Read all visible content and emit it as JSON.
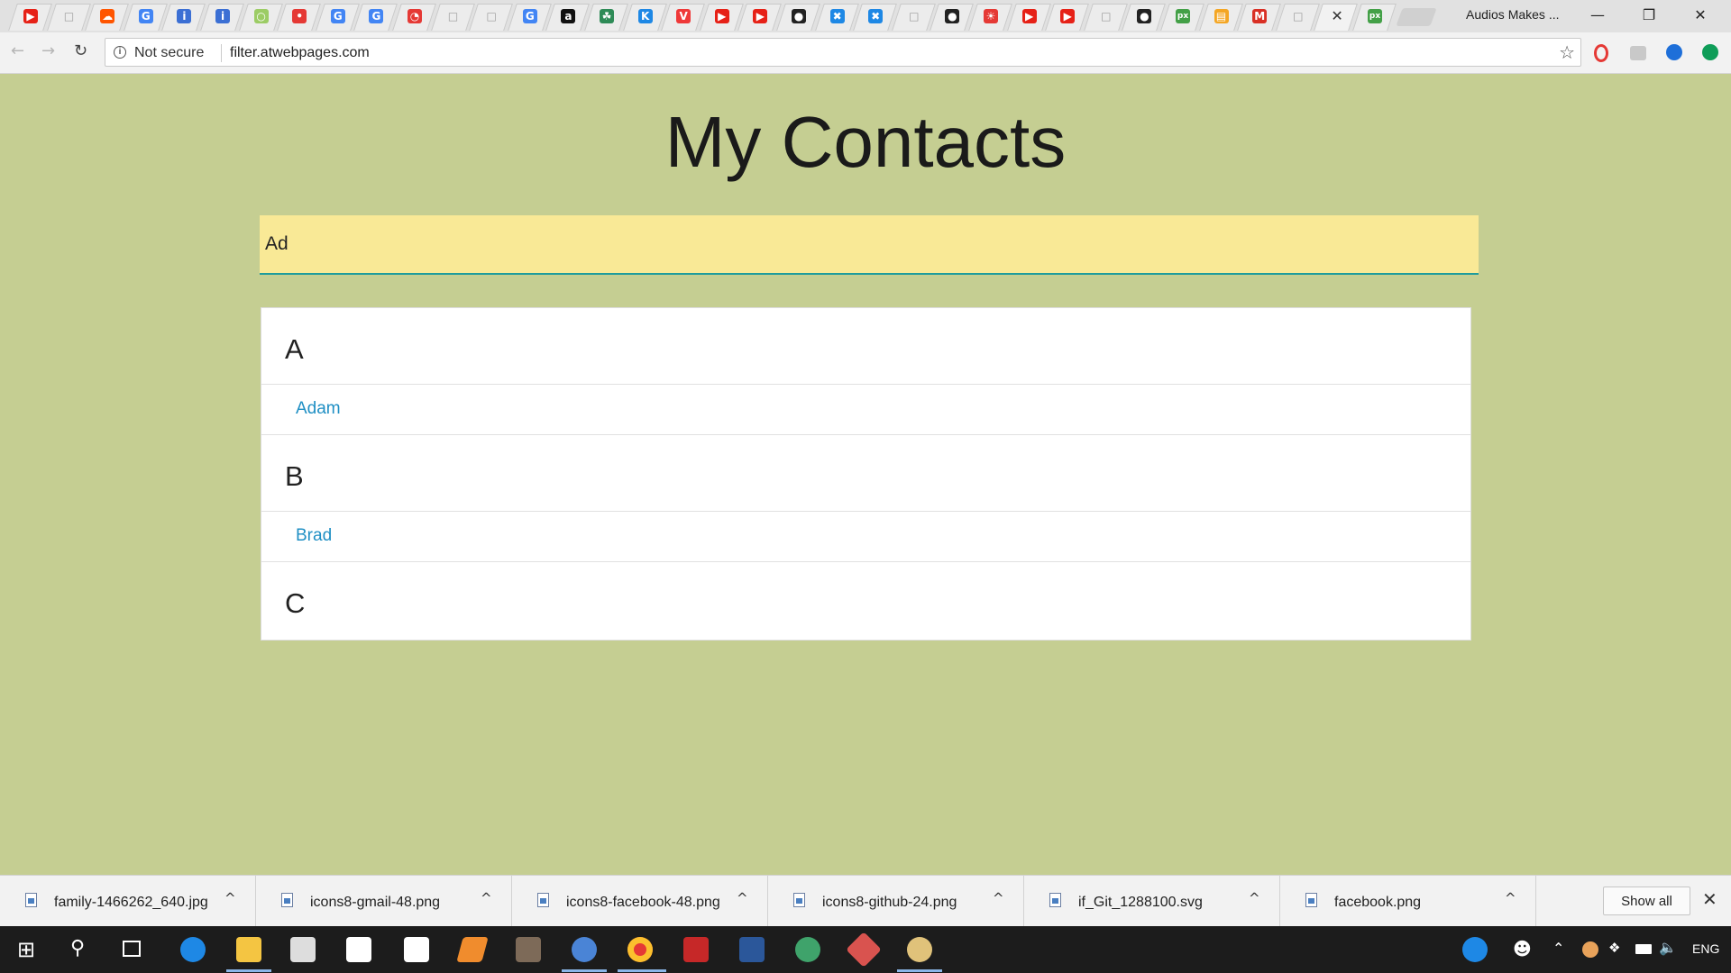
{
  "browser": {
    "profile_name": "Audios Makes ...",
    "security_label": "Not secure",
    "url": "filter.atwebpages.com",
    "tab_close_glyph": "✕",
    "tab_icons": [
      {
        "name": "youtube-icon",
        "glyph": "▶",
        "color": "#e62117"
      },
      {
        "name": "page-icon",
        "glyph": "□",
        "color": "#9a9a9a"
      },
      {
        "name": "soundcloud-icon",
        "glyph": "☁",
        "color": "#ff5500"
      },
      {
        "name": "google-icon",
        "glyph": "G",
        "color": "#4285f4"
      },
      {
        "name": "facebook-info-icon",
        "glyph": "i",
        "color": "#3b6fd4"
      },
      {
        "name": "facebook-info-icon",
        "glyph": "i",
        "color": "#3b6fd4"
      },
      {
        "name": "circle-icon",
        "glyph": "○",
        "color": "#9ccc65"
      },
      {
        "name": "code-icon",
        "glyph": "•",
        "color": "#e53935"
      },
      {
        "name": "google-icon",
        "glyph": "G",
        "color": "#4285f4"
      },
      {
        "name": "google-icon",
        "glyph": "G",
        "color": "#4285f4"
      },
      {
        "name": "pie-icon",
        "glyph": "◔",
        "color": "#e53935"
      },
      {
        "name": "page-icon",
        "glyph": "□",
        "color": "#9a9a9a"
      },
      {
        "name": "page-icon",
        "glyph": "□",
        "color": "#9a9a9a"
      },
      {
        "name": "google-icon",
        "glyph": "G",
        "color": "#4285f4"
      },
      {
        "name": "amazon-icon",
        "glyph": "a",
        "color": "#111111"
      },
      {
        "name": "leaf-icon",
        "glyph": "☘",
        "color": "#2e8b57"
      },
      {
        "name": "k-icon",
        "glyph": "K",
        "color": "#1e88e5"
      },
      {
        "name": "vivaldi-icon",
        "glyph": "V",
        "color": "#ef3939"
      },
      {
        "name": "youtube-icon",
        "glyph": "▶",
        "color": "#e62117"
      },
      {
        "name": "youtube-icon",
        "glyph": "▶",
        "color": "#e62117"
      },
      {
        "name": "github-icon",
        "glyph": "●",
        "color": "#222222"
      },
      {
        "name": "cross-icon",
        "glyph": "✖",
        "color": "#1e88e5"
      },
      {
        "name": "cross-icon",
        "glyph": "✖",
        "color": "#1e88e5"
      },
      {
        "name": "page-icon",
        "glyph": "□",
        "color": "#9a9a9a"
      },
      {
        "name": "github-icon",
        "glyph": "●",
        "color": "#222222"
      },
      {
        "name": "flame-icon",
        "glyph": "☀",
        "color": "#e53935"
      },
      {
        "name": "youtube-icon",
        "glyph": "▶",
        "color": "#e62117"
      },
      {
        "name": "youtube-icon",
        "glyph": "▶",
        "color": "#e62117"
      },
      {
        "name": "page-icon",
        "glyph": "□",
        "color": "#9a9a9a"
      },
      {
        "name": "github-icon",
        "glyph": "●",
        "color": "#222222"
      },
      {
        "name": "px-icon",
        "glyph": "px",
        "color": "#43a047"
      },
      {
        "name": "cart-icon",
        "glyph": "▤",
        "color": "#f4a623"
      },
      {
        "name": "gmail-icon",
        "glyph": "M",
        "color": "#d93025"
      },
      {
        "name": "page-icon",
        "glyph": "□",
        "color": "#9a9a9a"
      },
      {
        "name": "active-tab",
        "glyph": "",
        "color": "#f2f2f2"
      },
      {
        "name": "px-icon",
        "glyph": "px",
        "color": "#43a047"
      }
    ]
  },
  "page": {
    "title": "My Contacts",
    "filter_value": "Ad",
    "colors": {
      "background": "#c5ce92",
      "input": "#f9e996",
      "link": "#1f8fc4"
    }
  },
  "contacts": {
    "group_a": "A",
    "contact_adam": "Adam",
    "group_b": "B",
    "contact_brad": "Brad",
    "group_c": "C"
  },
  "downloads": {
    "items": [
      {
        "name": "family-1466262_640.jpg"
      },
      {
        "name": "icons8-gmail-48.png"
      },
      {
        "name": "icons8-facebook-48.png"
      },
      {
        "name": "icons8-github-24.png"
      },
      {
        "name": "if_Git_1288100.svg"
      },
      {
        "name": "facebook.png"
      }
    ],
    "caret_glyph": "^",
    "show_all_label": "Show all",
    "close_glyph": "✕"
  },
  "taskbar": {
    "language": "ENG"
  }
}
